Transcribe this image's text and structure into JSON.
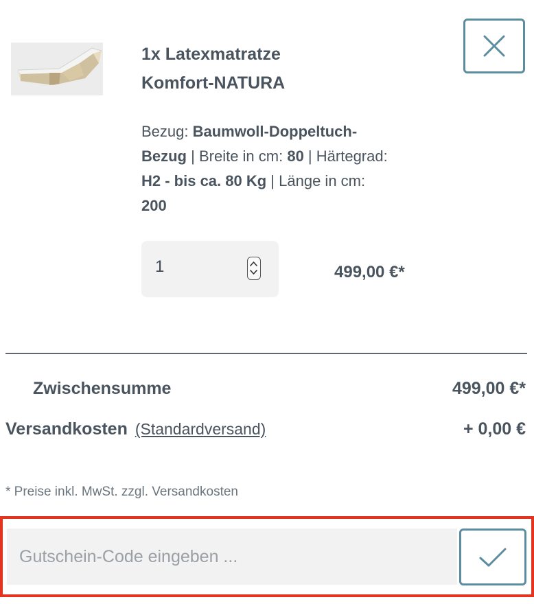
{
  "product": {
    "title_line1": "1x Latexmatratze",
    "title_line2": "Komfort-NATURA",
    "image_icon": "mattress-image",
    "variant": {
      "cover_label": "Bezug: ",
      "cover_value_line1": "Baumwoll-Doppeltuch-",
      "cover_value_line2": "Bezug",
      "separator": " | ",
      "width_label": "Breite in cm: ",
      "width_value": "80",
      "firmness_label": "Härtegrad:",
      "firmness_value": "H2 - bis ca. 80 Kg",
      "length_label": "Länge in cm:",
      "length_value": "200"
    },
    "quantity": "1",
    "price": "499,00 €*"
  },
  "remove_icon": "close-icon",
  "summary": {
    "subtotal_label": "Zwischensumme",
    "subtotal_value": "499,00 €*",
    "shipping_label": "Versandkosten",
    "shipping_method": "(Standardversand)",
    "shipping_value": "+ 0,00 €",
    "tax_note": "* Preise inkl. MwSt. zzgl. Versandkosten"
  },
  "voucher": {
    "placeholder": "Gutschein-Code eingeben ...",
    "value": "",
    "submit_icon": "checkmark-icon"
  },
  "colors": {
    "accent": "#5b8c9f",
    "highlight": "#e2341f",
    "text": "#4a545e",
    "field_bg": "#f2f2f2"
  }
}
